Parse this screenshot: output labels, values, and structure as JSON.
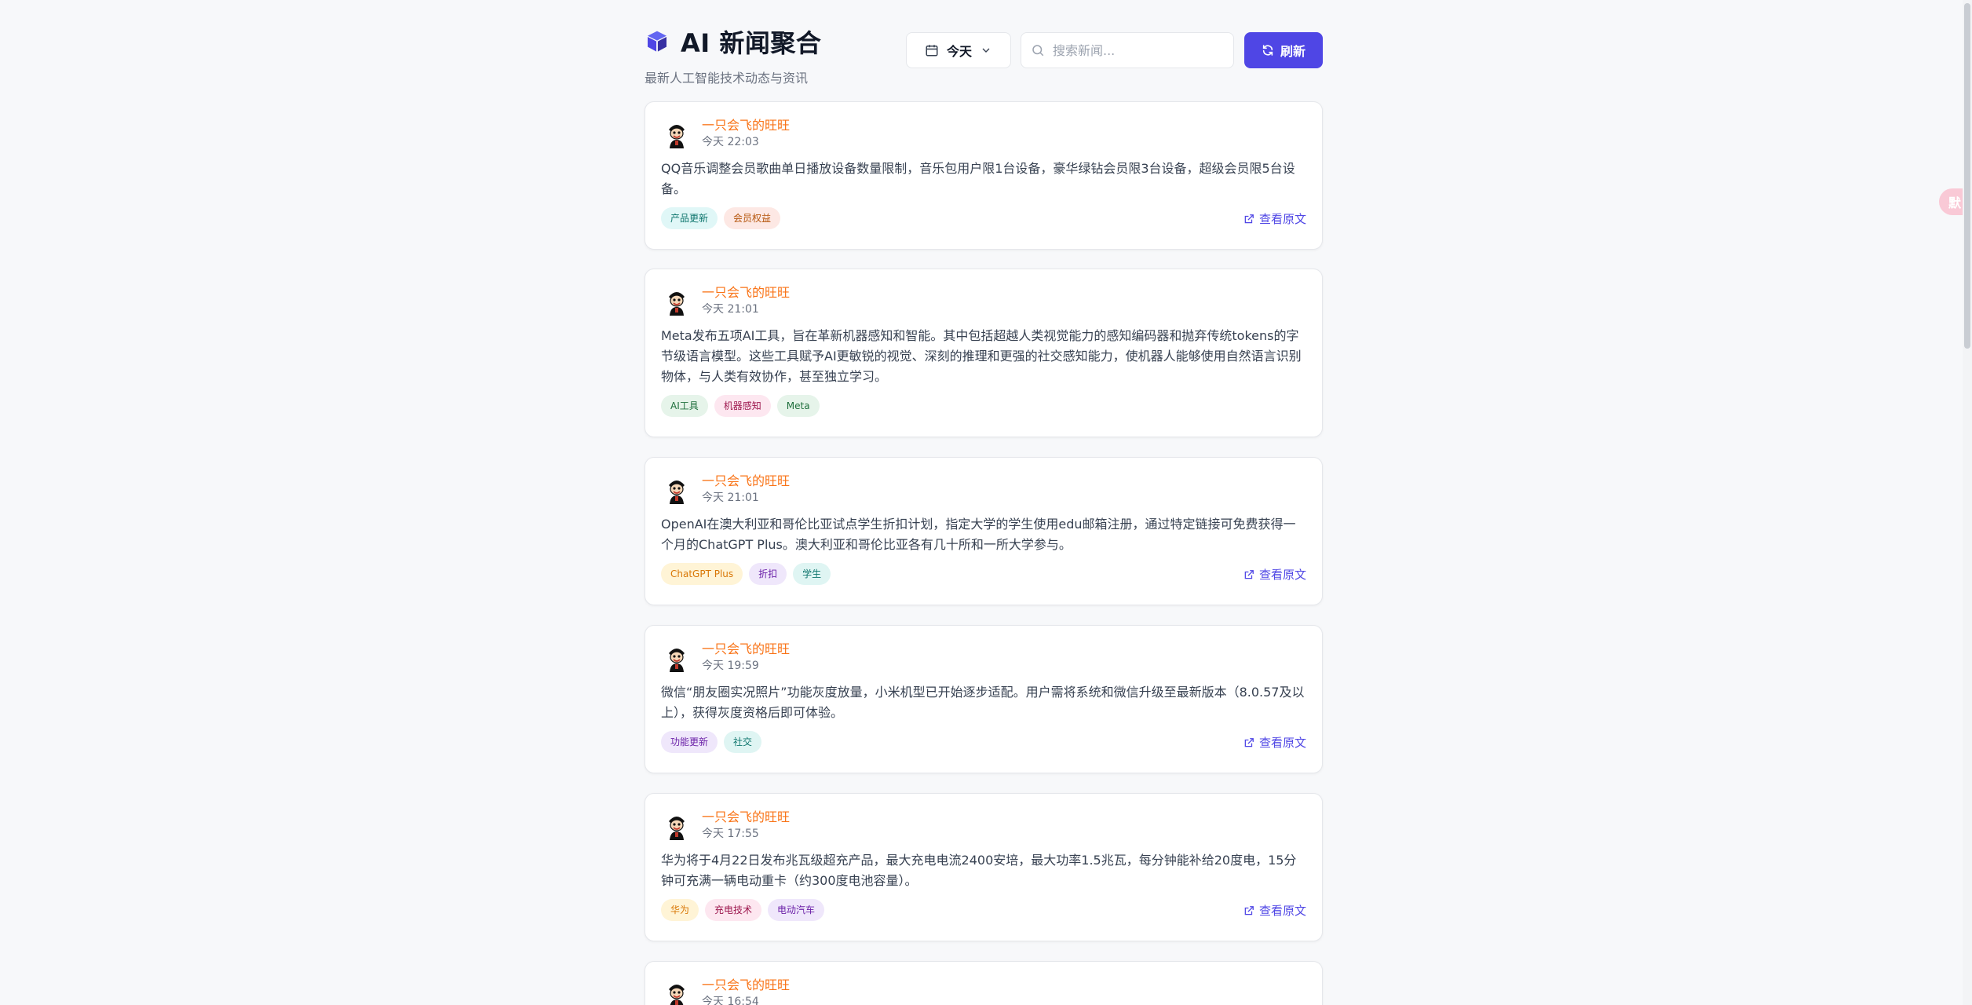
{
  "header": {
    "title": "AI 新闻聚合",
    "subtitle": "最新人工智能技术动态与资讯",
    "date_label": "今天",
    "search_placeholder": "搜索新闻...",
    "refresh_label": "刷新"
  },
  "accent_color": "#4f46e5",
  "author_color": "#f97316",
  "floating_tab_label": "默",
  "scrollbar": {
    "position_fraction": 0.0
  },
  "view_source_label": "查看原文",
  "news": [
    {
      "author": "一只会飞的旺旺",
      "time": "今天 22:03",
      "content": "QQ音乐调整会员歌曲单日播放设备数量限制，音乐包用户限1台设备，豪华绿钻会员限3台设备，超级会员限5台设备。",
      "tags": [
        {
          "label": "产品更新",
          "color": "cyan"
        },
        {
          "label": "会员权益",
          "color": "red"
        }
      ],
      "has_link": true
    },
    {
      "author": "一只会飞的旺旺",
      "time": "今天 21:01",
      "content": "Meta发布五项AI工具，旨在革新机器感知和智能。其中包括超越人类视觉能力的感知编码器和抛弃传统tokens的字节级语言模型。这些工具赋予AI更敏锐的视觉、深刻的推理和更强的社交感知能力，使机器人能够使用自然语言识别物体，与人类有效协作，甚至独立学习。",
      "tags": [
        {
          "label": "AI工具",
          "color": "green"
        },
        {
          "label": "机器感知",
          "color": "pink"
        },
        {
          "label": "Meta",
          "color": "green"
        }
      ],
      "has_link": false
    },
    {
      "author": "一只会飞的旺旺",
      "time": "今天 21:01",
      "content": "OpenAI在澳大利亚和哥伦比亚试点学生折扣计划，指定大学的学生使用edu邮箱注册，通过特定链接可免费获得一个月的ChatGPT Plus。澳大利亚和哥伦比亚各有几十所和一所大学参与。",
      "tags": [
        {
          "label": "ChatGPT Plus",
          "color": "amber"
        },
        {
          "label": "折扣",
          "color": "purple"
        },
        {
          "label": "学生",
          "color": "teal"
        }
      ],
      "has_link": true
    },
    {
      "author": "一只会飞的旺旺",
      "time": "今天 19:59",
      "content": "微信“朋友圈实况照片”功能灰度放量，小米机型已开始逐步适配。用户需将系统和微信升级至最新版本（8.0.57及以上），获得灰度资格后即可体验。",
      "tags": [
        {
          "label": "功能更新",
          "color": "purple"
        },
        {
          "label": "社交",
          "color": "teal"
        }
      ],
      "has_link": true
    },
    {
      "author": "一只会飞的旺旺",
      "time": "今天 17:55",
      "content": "华为将于4月22日发布兆瓦级超充产品，最大充电电流2400安培，最大功率1.5兆瓦，每分钟能补给20度电，15分钟可充满一辆电动重卡（约300度电池容量）。",
      "tags": [
        {
          "label": "华为",
          "color": "amber"
        },
        {
          "label": "充电技术",
          "color": "pink"
        },
        {
          "label": "电动汽车",
          "color": "purple"
        }
      ],
      "has_link": true
    },
    {
      "author": "一只会飞的旺旺",
      "time": "今天 16:54",
      "content": "",
      "tags": [],
      "has_link": false
    }
  ]
}
